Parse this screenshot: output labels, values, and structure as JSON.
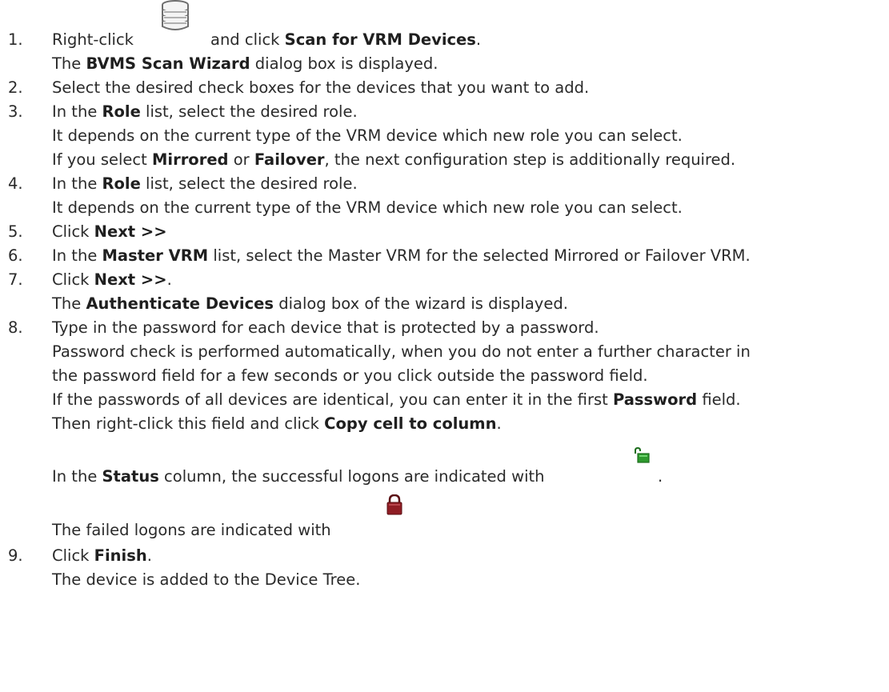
{
  "steps": [
    {
      "num": "1.",
      "lines": [
        {
          "before": "Right-click",
          "after": "and click",
          "bold": "Scan for VRM Devices",
          "end": "."
        },
        {
          "bold": "BVMS Scan Wizard",
          "text": " dialog box is displayed.",
          "prefix": "The "
        }
      ]
    },
    {
      "num": "2.",
      "text": "Select the desired check boxes for the devices that you want to add."
    },
    {
      "num": "3.",
      "l1": {
        "pre": "In the ",
        "bold": "Role",
        "post": " list, select the desired role."
      },
      "l2": "It depends on the current type of the VRM device which new role you can select.",
      "l3": {
        "pre": "If you select ",
        "b1": "Mirrored",
        "mid": " or ",
        "b2": "Failover",
        "post": ", the next configuration step is additionally required."
      }
    },
    {
      "num": "4.",
      "l1": {
        "pre": "In the ",
        "bold": "Role",
        "post": " list, select the desired role."
      },
      "l2": "It depends on the current type of the VRM device which new role you can select."
    },
    {
      "num": "5.",
      "pre": "Click ",
      "bold": "Next >>"
    },
    {
      "num": "6.",
      "pre": "In the ",
      "bold": "Master VRM",
      "post": " list, select the Master VRM for the selected Mirrored or Failover VRM."
    },
    {
      "num": "7.",
      "l1": {
        "pre": "Click ",
        "bold": "Next >>",
        "post": "."
      },
      "l2": {
        "pre": "The ",
        "bold": "Authenticate Devices",
        "post": " dialog box of the wizard is displayed."
      }
    },
    {
      "num": "8.",
      "l1": "Type in the password for each device that is protected by a password.",
      "l2": "Password check is performed automatically, when you do not enter a further character in",
      "l3": "the password field for a few seconds or you click outside the password field.",
      "l4": {
        "pre": "If the passwords of all devices are identical, you can enter it in the first ",
        "bold": "Password",
        "post": " field."
      },
      "l5": {
        "pre": "Then right-click this field and click ",
        "bold": "Copy cell to column",
        "post": "."
      },
      "l6": {
        "pre": "In the ",
        "bold": "Status",
        "post": " column, the successful logons are indicated with",
        "end": "."
      },
      "l7": "The failed logons are indicated with"
    },
    {
      "num": "9.",
      "l1": {
        "pre": "Click ",
        "bold": "Finish",
        "post": "."
      },
      "l2": "The device is added to the Device Tree."
    }
  ],
  "icons": {
    "device_tree_root": "database-stack-icon",
    "success": "unlocked-padlock-green-icon",
    "failed": "locked-padlock-red-icon"
  },
  "colors": {
    "success": "#2e9a2e",
    "failed": "#8f1d24",
    "text": "#2a2a2a"
  }
}
